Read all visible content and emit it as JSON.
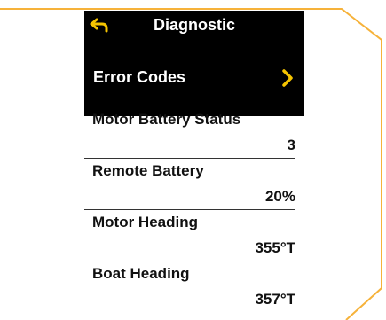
{
  "colors": {
    "frame": "#f6b23a",
    "header_bg": "#000000",
    "text_dark": "#111111",
    "chevron": "#f5c400"
  },
  "header": {
    "title": "Diagnostic",
    "back_icon": "back-arrow-icon"
  },
  "error_codes": {
    "label": "Error Codes",
    "icon": "chevron-right-icon"
  },
  "items": [
    {
      "name": "Motor Battery Status",
      "value": "3"
    },
    {
      "name": "Remote Battery",
      "value": "20%"
    },
    {
      "name": "Motor Heading",
      "value": "355°T"
    },
    {
      "name": "Boat Heading",
      "value": "357°T"
    }
  ]
}
